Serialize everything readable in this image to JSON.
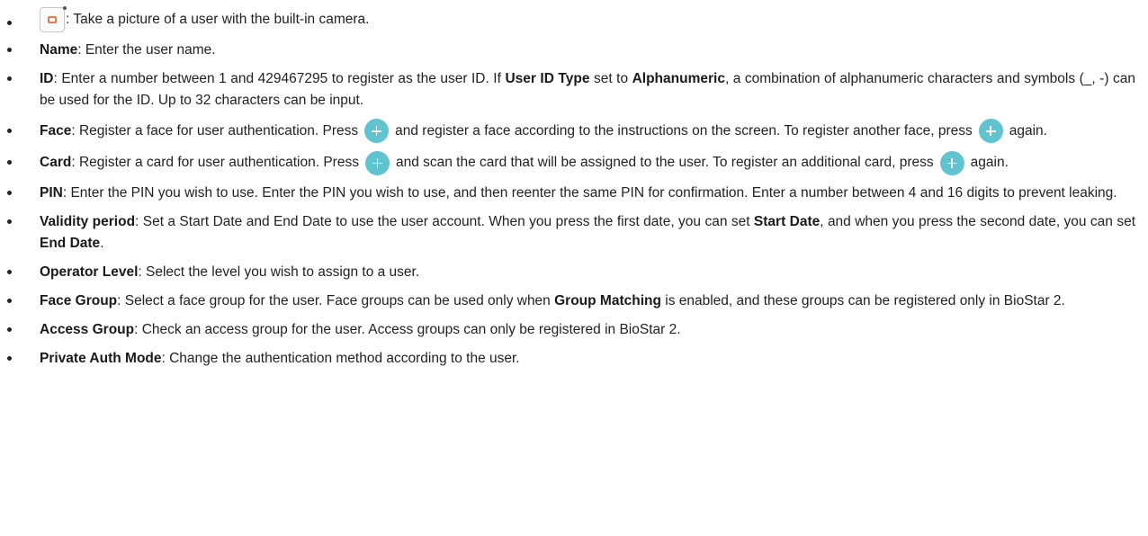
{
  "items": [
    {
      "icon": "camera-icon",
      "text": ": Take a picture of a user with the built-in camera."
    },
    {
      "term": "Name",
      "text": ": Enter the user name."
    },
    {
      "term": "ID",
      "text_a": ": Enter a number between 1 and 429467295 to register as the user ID. If ",
      "bold_a": "User ID Type",
      "text_b": " set to ",
      "bold_b": "Alphanumeric",
      "text_c": ", a combination of alphanumeric characters and symbols (_, -) can be used for the ID. Up to 32 characters can be input."
    },
    {
      "term": "Face",
      "text_a": ": Register a face for user authentication. Press",
      "text_b": "and register a face according to the instructions on the screen. To register another face, press",
      "text_c": "again."
    },
    {
      "term": "Card",
      "text_a": ": Register a card for user authentication. Press",
      "text_b": "and scan the card that will be assigned to the user. To register an additional card, press",
      "text_c": "again."
    },
    {
      "term": "PIN",
      "text": ": Enter the PIN you wish to use. Enter the PIN you wish to use, and then reenter the same PIN for confirmation. Enter a number between 4 and 16 digits to prevent leaking."
    },
    {
      "term": "Validity period",
      "text_a": ": Set a Start Date and End Date to use the user account. When you press the first date, you can set ",
      "bold_a": "Start Date",
      "text_b": ", and when you press the second date, you can set ",
      "bold_b": "End Date",
      "text_c": "."
    },
    {
      "term": "Operator Level",
      "text": ": Select the level you wish to assign to a user."
    },
    {
      "term": "Face Group",
      "text_a": ": Select a face group for the user. Face groups can be used only when ",
      "bold_a": "Group Matching",
      "text_b": " is enabled, and these groups can be registered only in BioStar 2."
    },
    {
      "term": "Access Group",
      "text": ": Check an access group for the user. Access groups can only be registered in BioStar 2."
    },
    {
      "term": "Private Auth Mode",
      "text": ": Change the authentication method according to the user."
    }
  ],
  "colors": {
    "plus_button": "#5fc4cf",
    "camera_lens": "#e07b50",
    "text": "#222222"
  }
}
